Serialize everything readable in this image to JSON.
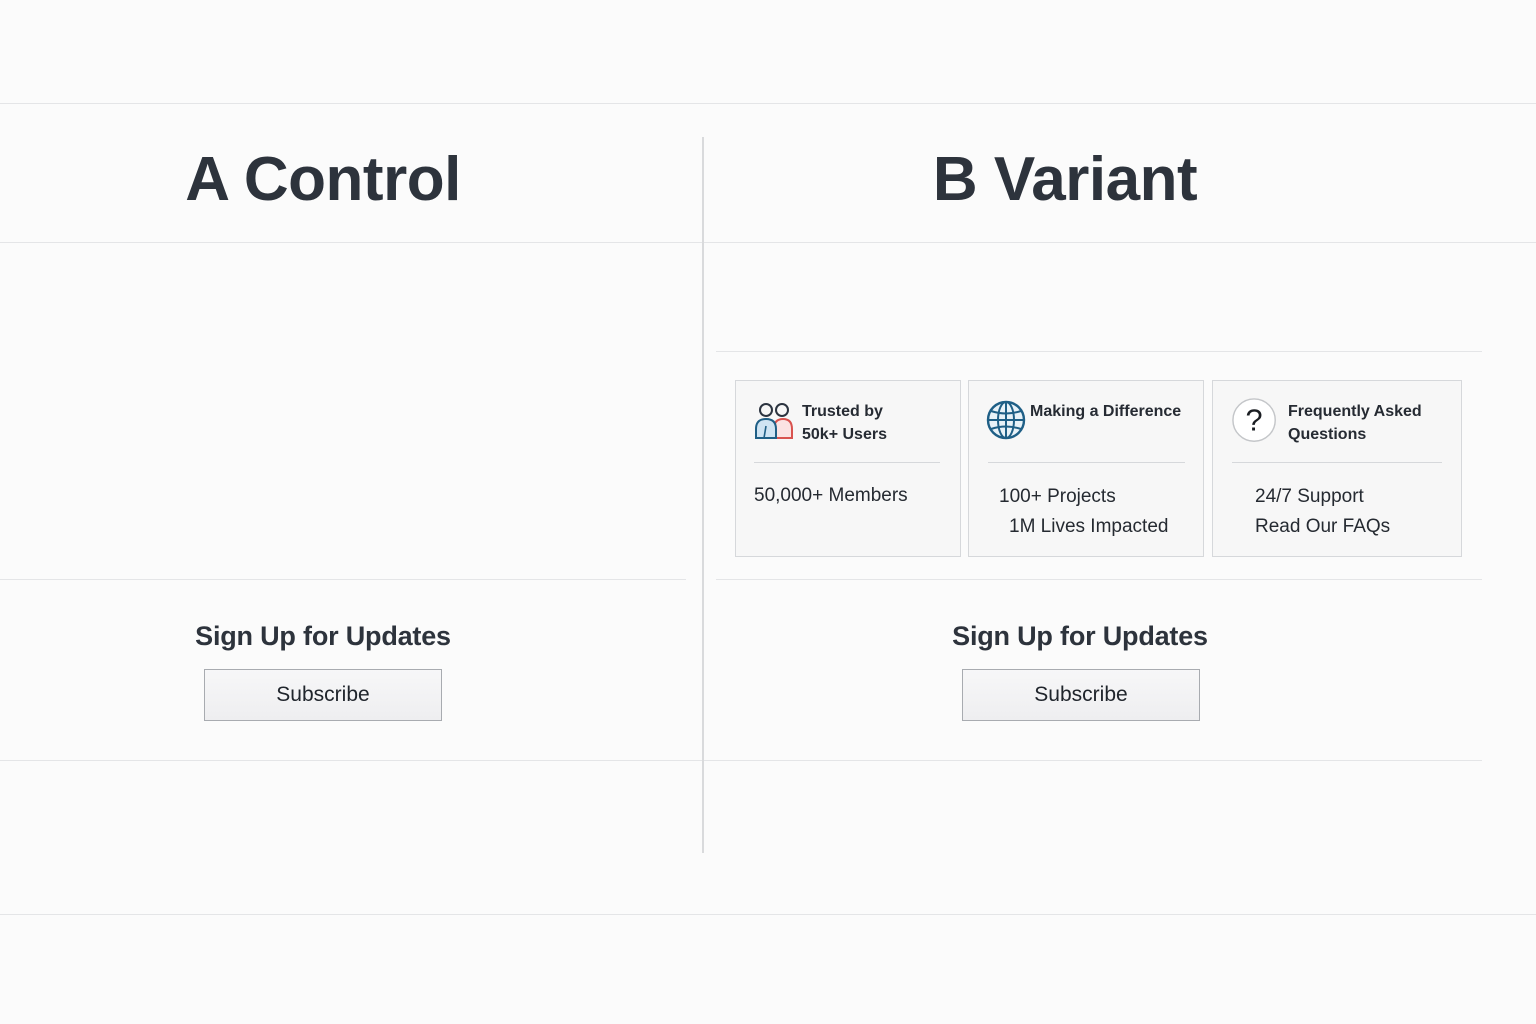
{
  "variant_a": {
    "title": "A Control",
    "signup_heading": "Sign Up for Updates",
    "subscribe_label": "Subscribe"
  },
  "variant_b": {
    "title": "B Variant",
    "signup_heading": "Sign Up for Updates",
    "subscribe_label": "Subscribe",
    "cards": [
      {
        "icon": "users-icon",
        "heading_line1": "Trusted by",
        "heading_line2": "50k+ Users",
        "stat_line1": "50,000+ Members"
      },
      {
        "icon": "globe-icon",
        "heading_line1": "Making a Difference",
        "stat_line1": "100+ Projects",
        "stat_line2": "1M Lives Impacted"
      },
      {
        "icon": "question-icon",
        "heading_line1": "Frequently Asked",
        "heading_line2": "Questions",
        "stat_line1": "24/7 Support",
        "stat_line2": "Read Our FAQs"
      }
    ]
  },
  "colors": {
    "background": "#fbfbfb",
    "text": "#2d333c",
    "divider": "#e4e5e7",
    "card_background": "#f7f7f7",
    "icon_blue": "#1f5f86",
    "icon_red": "#d9534f"
  }
}
